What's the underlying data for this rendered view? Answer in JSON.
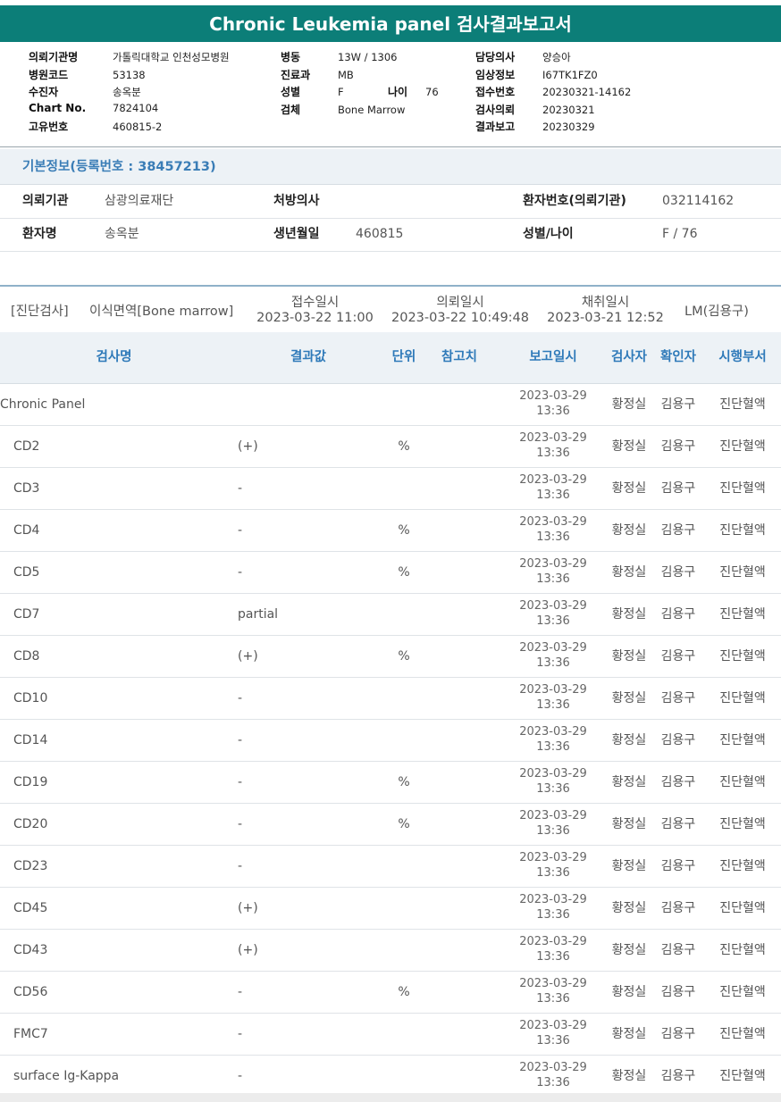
{
  "report": {
    "title": "Chronic Leukemia panel 검사결과보고서",
    "col1": [
      {
        "label": "의뢰기관명",
        "value": "가톨릭대학교 인천성모병원"
      },
      {
        "label": "병원코드",
        "value": "53138"
      },
      {
        "label": "수진자",
        "value": "송옥분"
      },
      {
        "label": "Chart No.",
        "value": "7824104"
      },
      {
        "label": "고유번호",
        "value": "460815-2"
      }
    ],
    "col2": [
      {
        "label": "병동",
        "value": "13W / 1306"
      },
      {
        "label": "진료과",
        "value": "MB"
      },
      {
        "label": "성별",
        "value": "F"
      },
      {
        "label": "검체",
        "value": "Bone Marrow"
      }
    ],
    "age_label": "나이",
    "age_value": "76",
    "col3": [
      {
        "label": "담당의사",
        "value": "양승아"
      },
      {
        "label": "임상정보",
        "value": "I67TK1FZ0"
      },
      {
        "label": "접수번호",
        "value": "20230321-14162"
      },
      {
        "label": "검사의뢰",
        "value": "20230321"
      },
      {
        "label": "결과보고",
        "value": "20230329"
      }
    ]
  },
  "basic": {
    "heading": "기본정보(등록번호 : 38457213)",
    "institution_label": "의뢰기관",
    "institution": "삼광의료재단",
    "doctor_label": "처방의사",
    "doctor": "",
    "patient_no_label": "환자번호(의뢰기관)",
    "patient_no": "032114162",
    "name_label": "환자명",
    "name": "송옥분",
    "dob_label": "생년월일",
    "dob": "460815",
    "sex_age_label": "성별/나이",
    "sex_age": "F / 76"
  },
  "diag": {
    "category": "[진단검사]",
    "specimen": "이식면역[Bone marrow]",
    "received_label": "접수일시",
    "received": "2023-03-22 11:00",
    "requested_label": "의뢰일시",
    "requested": "2023-03-22 10:49:48",
    "collected_label": "채취일시",
    "collected": "2023-03-21 12:52",
    "lab": "LM(김용구)"
  },
  "table": {
    "headers": {
      "name": "검사명",
      "result": "결과값",
      "unit": "단위",
      "ref": "참고치",
      "reported": "보고일시",
      "tester": "검사자",
      "confirmer": "확인자",
      "dept": "시행부서"
    },
    "rows": [
      {
        "name": "Chronic Panel",
        "result": "",
        "unit": "",
        "date": "2023-03-29",
        "time": "13:36",
        "tester": "황정실",
        "confirmer": "김용구",
        "dept": "진단혈액"
      },
      {
        "name": "CD2",
        "result": "(+)",
        "unit": "%",
        "date": "2023-03-29",
        "time": "13:36",
        "tester": "황정실",
        "confirmer": "김용구",
        "dept": "진단혈액"
      },
      {
        "name": "CD3",
        "result": "-",
        "unit": "",
        "date": "2023-03-29",
        "time": "13:36",
        "tester": "황정실",
        "confirmer": "김용구",
        "dept": "진단혈액"
      },
      {
        "name": "CD4",
        "result": "-",
        "unit": "%",
        "date": "2023-03-29",
        "time": "13:36",
        "tester": "황정실",
        "confirmer": "김용구",
        "dept": "진단혈액"
      },
      {
        "name": "CD5",
        "result": "-",
        "unit": "%",
        "date": "2023-03-29",
        "time": "13:36",
        "tester": "황정실",
        "confirmer": "김용구",
        "dept": "진단혈액"
      },
      {
        "name": "CD7",
        "result": "partial",
        "unit": "",
        "date": "2023-03-29",
        "time": "13:36",
        "tester": "황정실",
        "confirmer": "김용구",
        "dept": "진단혈액"
      },
      {
        "name": "CD8",
        "result": "(+)",
        "unit": "%",
        "date": "2023-03-29",
        "time": "13:36",
        "tester": "황정실",
        "confirmer": "김용구",
        "dept": "진단혈액"
      },
      {
        "name": "CD10",
        "result": "-",
        "unit": "",
        "date": "2023-03-29",
        "time": "13:36",
        "tester": "황정실",
        "confirmer": "김용구",
        "dept": "진단혈액"
      },
      {
        "name": "CD14",
        "result": "-",
        "unit": "",
        "date": "2023-03-29",
        "time": "13:36",
        "tester": "황정실",
        "confirmer": "김용구",
        "dept": "진단혈액"
      },
      {
        "name": "CD19",
        "result": "-",
        "unit": "%",
        "date": "2023-03-29",
        "time": "13:36",
        "tester": "황정실",
        "confirmer": "김용구",
        "dept": "진단혈액"
      },
      {
        "name": "CD20",
        "result": "-",
        "unit": "%",
        "date": "2023-03-29",
        "time": "13:36",
        "tester": "황정실",
        "confirmer": "김용구",
        "dept": "진단혈액"
      },
      {
        "name": "CD23",
        "result": "-",
        "unit": "",
        "date": "2023-03-29",
        "time": "13:36",
        "tester": "황정실",
        "confirmer": "김용구",
        "dept": "진단혈액"
      },
      {
        "name": "CD45",
        "result": "(+)",
        "unit": "",
        "date": "2023-03-29",
        "time": "13:36",
        "tester": "황정실",
        "confirmer": "김용구",
        "dept": "진단혈액"
      },
      {
        "name": "CD43",
        "result": "(+)",
        "unit": "",
        "date": "2023-03-29",
        "time": "13:36",
        "tester": "황정실",
        "confirmer": "김용구",
        "dept": "진단혈액"
      },
      {
        "name": "CD56",
        "result": "-",
        "unit": "%",
        "date": "2023-03-29",
        "time": "13:36",
        "tester": "황정실",
        "confirmer": "김용구",
        "dept": "진단혈액"
      },
      {
        "name": "FMC7",
        "result": "-",
        "unit": "",
        "date": "2023-03-29",
        "time": "13:36",
        "tester": "황정실",
        "confirmer": "김용구",
        "dept": "진단혈액"
      },
      {
        "name": "surface Ig-Kappa",
        "result": "-",
        "unit": "",
        "date": "2023-03-29",
        "time": "13:36",
        "tester": "황정실",
        "confirmer": "김용구",
        "dept": "진단혈액"
      }
    ]
  }
}
